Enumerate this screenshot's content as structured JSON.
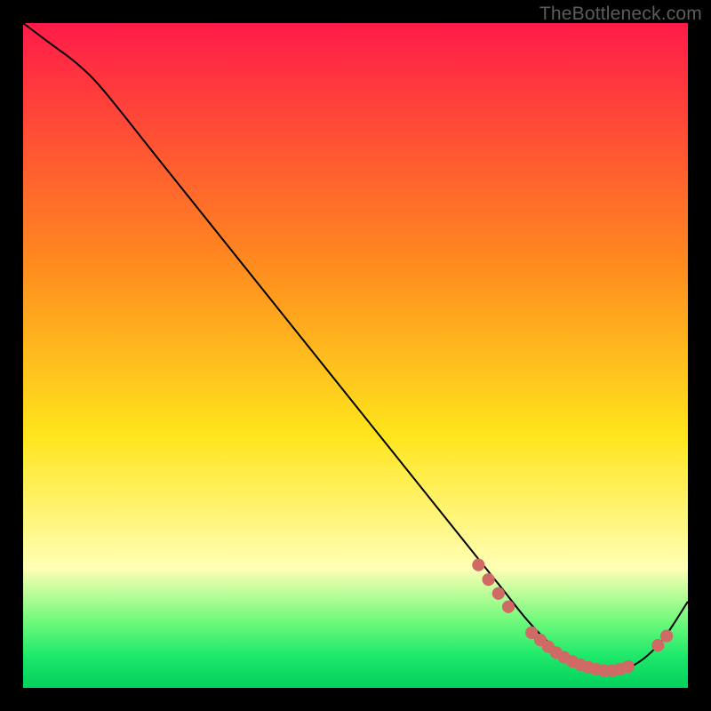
{
  "watermark": "TheBottleneck.com",
  "colors": {
    "top": "#ff1b49",
    "mid1": "#ff8a1f",
    "mid2": "#ffe51c",
    "lowPale": "#ffffb5",
    "greenTop": "#6ff97b",
    "greenMid": "#20e96b",
    "greenBottom": "#00d05c",
    "curve": "#000000",
    "dot": "#cf6a65"
  },
  "chart_data": {
    "type": "line",
    "title": "",
    "xlabel": "",
    "ylabel": "",
    "xlim": [
      0,
      100
    ],
    "ylim": [
      0,
      100
    ],
    "series": [
      {
        "name": "curve",
        "x": [
          0,
          4,
          8,
          12,
          20,
          30,
          40,
          50,
          60,
          68,
          72,
          76,
          80,
          84,
          88,
          92,
          96,
          100
        ],
        "y": [
          100,
          97,
          94,
          90,
          80,
          67.5,
          55,
          42.5,
          30,
          20,
          15,
          10,
          6,
          3.5,
          2.5,
          3.5,
          7,
          13
        ]
      }
    ],
    "dots": {
      "name": "highlight",
      "points": [
        {
          "x": 68.5,
          "y": 18.5
        },
        {
          "x": 70.0,
          "y": 16.3
        },
        {
          "x": 71.5,
          "y": 14.2
        },
        {
          "x": 73.0,
          "y": 12.2
        },
        {
          "x": 76.5,
          "y": 8.3
        },
        {
          "x": 77.8,
          "y": 7.2
        },
        {
          "x": 79.0,
          "y": 6.2
        },
        {
          "x": 80.2,
          "y": 5.3
        },
        {
          "x": 81.4,
          "y": 4.6
        },
        {
          "x": 82.6,
          "y": 4.0
        },
        {
          "x": 83.8,
          "y": 3.5
        },
        {
          "x": 85.0,
          "y": 3.1
        },
        {
          "x": 86.2,
          "y": 2.8
        },
        {
          "x": 87.4,
          "y": 2.6
        },
        {
          "x": 88.6,
          "y": 2.6
        },
        {
          "x": 89.8,
          "y": 2.8
        },
        {
          "x": 91.0,
          "y": 3.2
        },
        {
          "x": 95.5,
          "y": 6.4
        },
        {
          "x": 96.8,
          "y": 7.8
        }
      ]
    }
  }
}
